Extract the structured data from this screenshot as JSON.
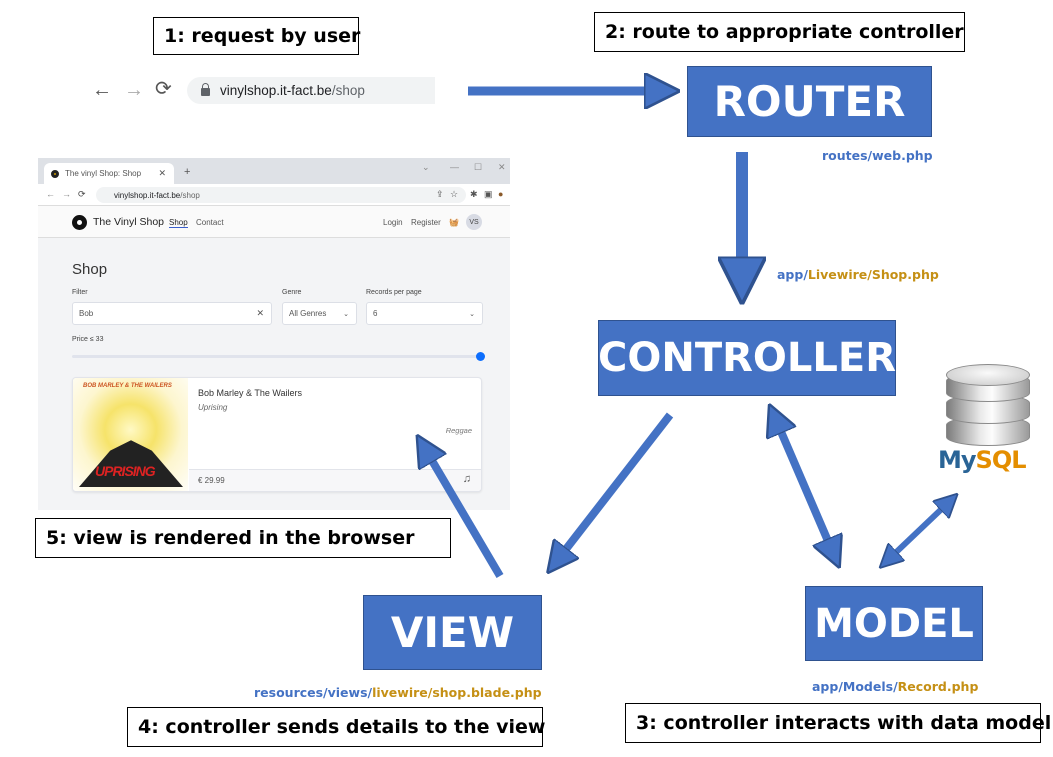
{
  "steps": {
    "step1": "1: request by user",
    "step2": "2: route to appropriate controller",
    "step3": "3: controller interacts with data model",
    "step4": "4: controller sends details to the view",
    "step5": "5: view is rendered in the browser"
  },
  "blocks": {
    "router": "ROUTER",
    "controller": "CONTROLLER",
    "view": "VIEW",
    "model": "MODEL"
  },
  "paths": {
    "router": [
      {
        "text": "routes/web.php",
        "color": "blue"
      }
    ],
    "controller": [
      {
        "text": "app/",
        "color": "blue"
      },
      {
        "text": "Livewire/Shop.php",
        "color": "gold"
      }
    ],
    "view": [
      {
        "text": "resources/views/",
        "color": "blue"
      },
      {
        "text": "livewire/shop.blade.php",
        "color": "gold"
      }
    ],
    "model": [
      {
        "text": "app/Models/",
        "color": "blue"
      },
      {
        "text": "Record.php",
        "color": "gold"
      }
    ]
  },
  "browser_bar": {
    "back": "←",
    "forward": "→",
    "reload": "⟳",
    "url_host": "vinylshop.it-fact.be",
    "url_path": "/shop"
  },
  "screenshot": {
    "tab_title": "The vinyl Shop: Shop",
    "tab_close": "✕",
    "tab_new": "+",
    "win_controls": [
      "⌄",
      "—",
      "☐",
      "✕"
    ],
    "url_host": "vinylshop.it-fact.be",
    "url_path": "/shop",
    "brand": "The Vinyl Shop",
    "nav": {
      "shop": "Shop",
      "contact": "Contact",
      "login": "Login",
      "register": "Register",
      "basket": "🧺",
      "avatar": "VS"
    },
    "page_title": "Shop",
    "filter": {
      "label": "Filter",
      "value": "Bob",
      "clear": "✕"
    },
    "genre": {
      "label": "Genre",
      "value": "All Genres"
    },
    "per_page": {
      "label": "Records per page",
      "value": "6"
    },
    "price": {
      "label": "Price ≤ 33",
      "slider_fraction": 1.0
    },
    "record": {
      "cover_title": "BOB MARLEY & THE WAILERS",
      "cover_word": "UPRISING",
      "artist": "Bob Marley & The Wailers",
      "album": "Uprising",
      "genre": "Reggae",
      "price": "€ 29.99",
      "music_icon": "♫"
    }
  },
  "database": {
    "logo_my": "My",
    "logo_sql": "SQL"
  },
  "colors": {
    "block": "#4472c4",
    "path_blue": "#4472c4",
    "path_gold": "#c59015"
  }
}
